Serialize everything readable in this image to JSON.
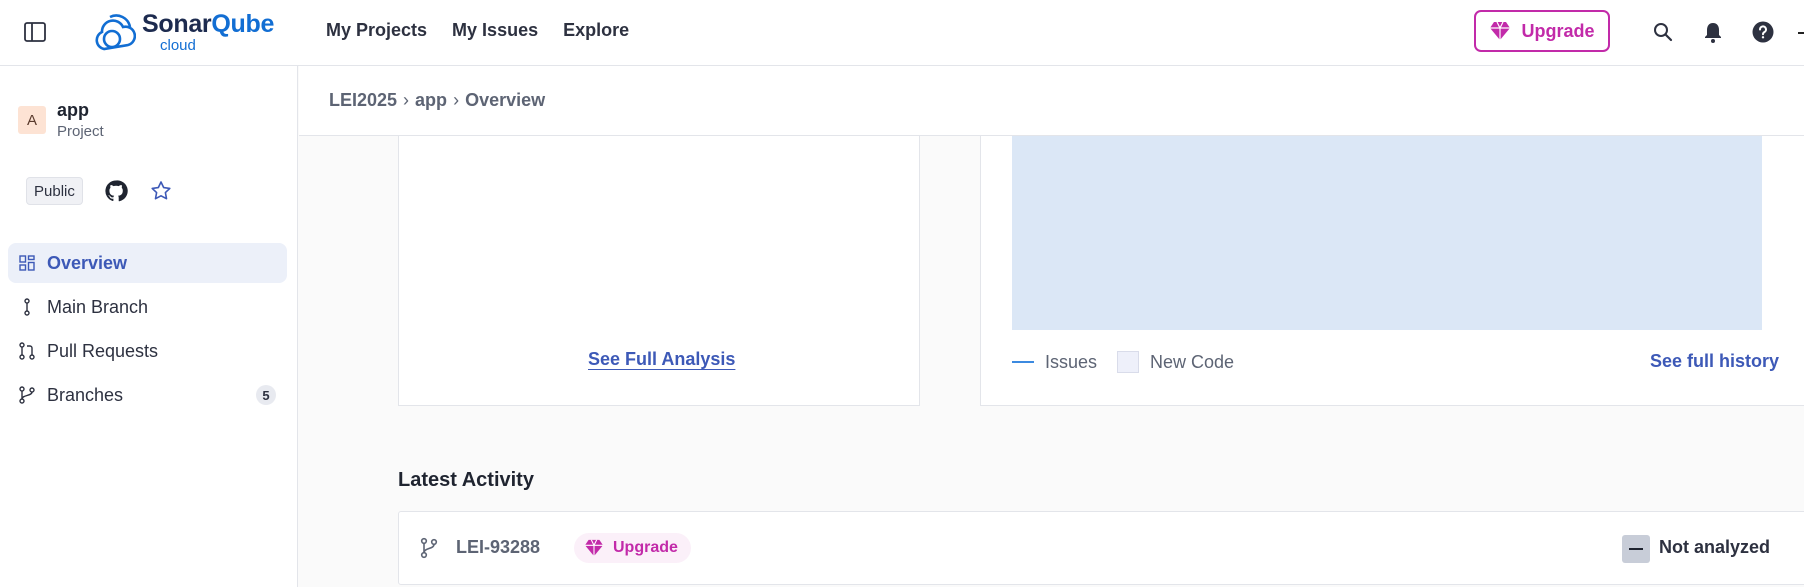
{
  "header": {
    "logo_main_a": "Sonar",
    "logo_main_b": "Qube",
    "logo_sub": "cloud",
    "nav": [
      "My Projects",
      "My Issues",
      "Explore"
    ],
    "upgrade_label": "Upgrade",
    "icons": [
      "sidebar-toggle-icon",
      "search-icon",
      "bell-icon",
      "help-icon"
    ]
  },
  "project": {
    "avatar_letter": "A",
    "name": "app",
    "type": "Project",
    "visibility": "Public"
  },
  "sidebar": {
    "items": [
      {
        "label": "Overview",
        "icon": "grid-icon",
        "active": true
      },
      {
        "label": "Main Branch",
        "icon": "branch-line-icon"
      },
      {
        "label": "Pull Requests",
        "icon": "pull-request-icon"
      },
      {
        "label": "Branches",
        "icon": "branches-icon",
        "count": "5"
      }
    ]
  },
  "breadcrumb": [
    "LEI2025",
    "app",
    "Overview"
  ],
  "analysis_card": {
    "link": "See Full Analysis"
  },
  "history_card": {
    "legend_issues": "Issues",
    "legend_new_code": "New Code",
    "link": "See full history",
    "colors": {
      "chart_fill": "#dbe7f6",
      "issues_line": "#3c8ae0"
    }
  },
  "latest_activity": {
    "title": "Latest Activity",
    "rows": [
      {
        "branch": "LEI-93288",
        "badge": "Upgrade",
        "status": "Not analyzed"
      }
    ]
  },
  "colors": {
    "accent": "#3d59b7",
    "upgrade": "#c22aa9",
    "brand": "#126ed3"
  }
}
